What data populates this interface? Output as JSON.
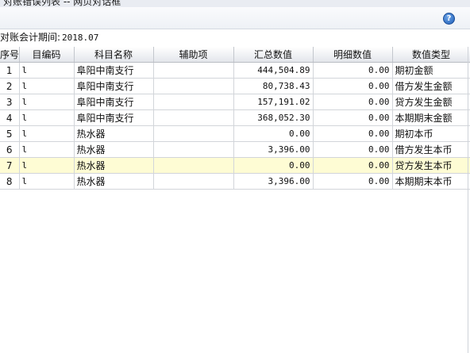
{
  "window": {
    "title": "对账错误列表 -- 网页对话框"
  },
  "toolbar": {
    "help_glyph": "?",
    "help_icon": "help-icon"
  },
  "period": {
    "label": "对账会计期间:",
    "value": "2018.07"
  },
  "table": {
    "columns": [
      "序号",
      "目编码",
      "科目名称",
      "辅助项",
      "汇总数值",
      "明细数值",
      "数值类型"
    ],
    "rows": [
      {
        "idx": "1",
        "code": "l",
        "name": "阜阳中南支行",
        "aux": "",
        "sum": "444,504.89",
        "detail": "0.00",
        "type": "期初金额"
      },
      {
        "idx": "2",
        "code": "l",
        "name": "阜阳中南支行",
        "aux": "",
        "sum": "80,738.43",
        "detail": "0.00",
        "type": "借方发生金额"
      },
      {
        "idx": "3",
        "code": "l",
        "name": "阜阳中南支行",
        "aux": "",
        "sum": "157,191.02",
        "detail": "0.00",
        "type": "贷方发生金额"
      },
      {
        "idx": "4",
        "code": "l",
        "name": "阜阳中南支行",
        "aux": "",
        "sum": "368,052.30",
        "detail": "0.00",
        "type": "本期期末金额"
      },
      {
        "idx": "5",
        "code": "l",
        "name": "热水器",
        "aux": "",
        "sum": "0.00",
        "detail": "0.00",
        "type": "期初本币"
      },
      {
        "idx": "6",
        "code": "l",
        "name": "热水器",
        "aux": "",
        "sum": "3,396.00",
        "detail": "0.00",
        "type": "借方发生本币"
      },
      {
        "idx": "7",
        "code": "l",
        "name": "热水器",
        "aux": "",
        "sum": "0.00",
        "detail": "0.00",
        "type": "贷方发生本币"
      },
      {
        "idx": "8",
        "code": "l",
        "name": "热水器",
        "aux": "",
        "sum": "3,396.00",
        "detail": "0.00",
        "type": "本期期末本币"
      }
    ]
  },
  "colors": {
    "selected_row": "#fefcd4",
    "header_bg": "#e3e6eb",
    "help_icon": "#1f5db8"
  }
}
